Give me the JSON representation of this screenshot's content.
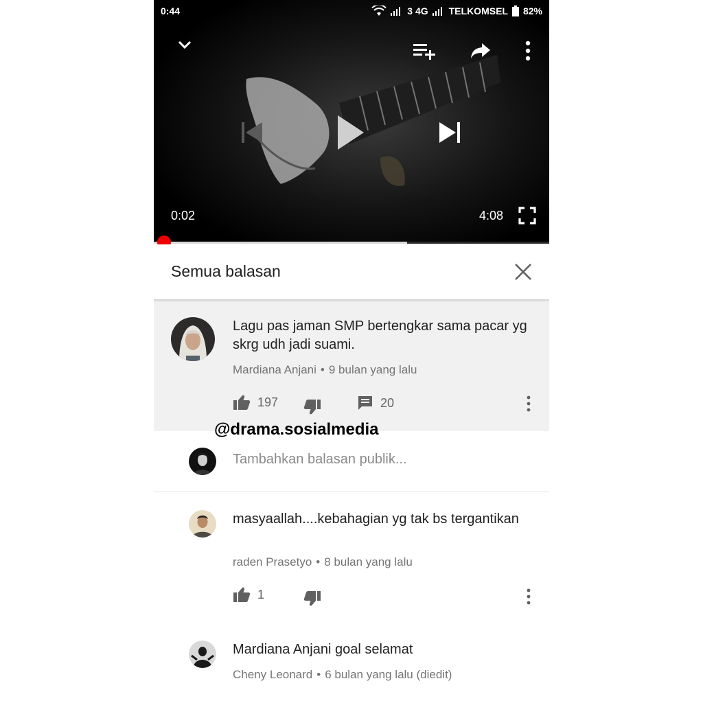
{
  "status_bar": {
    "time": "0:44",
    "network": "3 4G",
    "carrier": "TELKOMSEL",
    "battery": "82%"
  },
  "player": {
    "elapsed": "0:02",
    "duration": "4:08",
    "progress_fraction": 0.008,
    "buffered_fraction": 0.64,
    "progress_color": "#ee0000"
  },
  "replies_panel": {
    "title": "Semua balasan"
  },
  "parent_comment": {
    "text": "Lagu pas jaman SMP bertengkar sama pacar yg skrg udh jadi suami.",
    "author": "Mardiana Anjani",
    "time": "9 bulan yang lalu",
    "likes": "197",
    "replies": "20"
  },
  "watermark": "@drama.sosialmedia",
  "reply_box": {
    "placeholder": "Tambahkan balasan publik..."
  },
  "replies": [
    {
      "text": "masyaallah....kebahagian yg tak bs tergantikan",
      "author": "raden Prasetyo",
      "time": "8 bulan yang lalu",
      "likes": "1"
    },
    {
      "text": "Mardiana Anjani goal selamat",
      "author": "Cheny Leonard",
      "time": "6 bulan yang lalu (diedit)"
    }
  ],
  "meta_separator": "•",
  "icons": [
    "chevron-down-icon",
    "add-to-queue-icon",
    "share-icon",
    "more-vert-icon",
    "previous-icon",
    "play-icon",
    "next-icon",
    "fullscreen-icon",
    "close-icon",
    "thumb-up-icon",
    "thumb-down-icon",
    "comment-icon"
  ]
}
